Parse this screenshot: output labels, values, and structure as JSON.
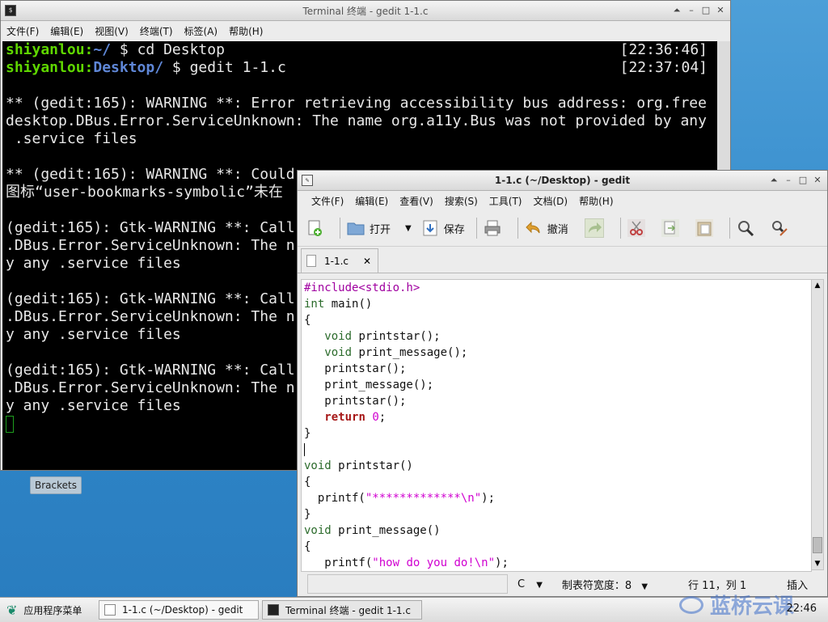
{
  "terminal": {
    "title": "Terminal 终端 - gedit 1-1.c",
    "menu": [
      "文件(F)",
      "编辑(E)",
      "视图(V)",
      "终端(T)",
      "标签(A)",
      "帮助(H)"
    ],
    "lines": [
      {
        "user": "shiyanlou",
        "path": "~/",
        "cmd": " $ cd Desktop",
        "time": "[22:36:46]"
      },
      {
        "user": "shiyanlou",
        "path": "Desktop/",
        "cmd": " $ gedit 1-1.c",
        "time": "[22:37:04]"
      },
      {
        "text": ""
      },
      {
        "text": "** (gedit:165): WARNING **: Error retrieving accessibility bus address: org.free"
      },
      {
        "text": "desktop.DBus.Error.ServiceUnknown: The name org.a11y.Bus was not provided by any"
      },
      {
        "text": " .service files"
      },
      {
        "text": ""
      },
      {
        "text": "** (gedit:165): WARNING **: Could"
      },
      {
        "text": "图标“user-bookmarks-symbolic”未在"
      },
      {
        "text": ""
      },
      {
        "text": "(gedit:165): Gtk-WARNING **: Call"
      },
      {
        "text": ".DBus.Error.ServiceUnknown: The n"
      },
      {
        "text": "y any .service files"
      },
      {
        "text": ""
      },
      {
        "text": "(gedit:165): Gtk-WARNING **: Call"
      },
      {
        "text": ".DBus.Error.ServiceUnknown: The n"
      },
      {
        "text": "y any .service files"
      },
      {
        "text": ""
      },
      {
        "text": "(gedit:165): Gtk-WARNING **: Call"
      },
      {
        "text": ".DBus.Error.ServiceUnknown: The n"
      },
      {
        "text": "y any .service files"
      }
    ]
  },
  "desktop": {
    "brackets_label": "Brackets"
  },
  "gedit": {
    "title": "1-1.c (~/Desktop) - gedit",
    "menu": [
      "文件(F)",
      "编辑(E)",
      "查看(V)",
      "搜索(S)",
      "工具(T)",
      "文档(D)",
      "帮助(H)"
    ],
    "toolbar": {
      "open": "打开",
      "save": "保存",
      "undo": "撤消"
    },
    "tab": "1-1.c",
    "code": [
      [
        [
          "pp",
          "#include<stdio.h>"
        ]
      ],
      [
        [
          "kw",
          "int"
        ],
        [
          "",
          " main()"
        ]
      ],
      [
        [
          "",
          "{"
        ]
      ],
      [
        [
          "",
          "   "
        ],
        [
          "kw",
          "void"
        ],
        [
          "",
          " printstar();"
        ]
      ],
      [
        [
          "",
          "   "
        ],
        [
          "kw",
          "void"
        ],
        [
          "",
          " print_message();"
        ]
      ],
      [
        [
          "",
          "   printstar();"
        ]
      ],
      [
        [
          "",
          "   print_message();"
        ]
      ],
      [
        [
          "",
          "   printstar();"
        ]
      ],
      [
        [
          "",
          "   "
        ],
        [
          "kw2",
          "return"
        ],
        [
          "",
          " "
        ],
        [
          "str",
          "0"
        ],
        [
          "",
          ";"
        ]
      ],
      [
        [
          "",
          "}"
        ]
      ],
      [
        [
          "",
          ""
        ]
      ],
      [
        [
          "kw",
          "void"
        ],
        [
          "",
          " printstar()"
        ]
      ],
      [
        [
          "",
          "{"
        ]
      ],
      [
        [
          "",
          "  printf("
        ],
        [
          "str",
          "\"*************\\n\""
        ],
        [
          "",
          ");"
        ]
      ],
      [
        [
          "",
          "}"
        ]
      ],
      [
        [
          "kw",
          "void"
        ],
        [
          "",
          " print_message()"
        ]
      ],
      [
        [
          "",
          "{"
        ]
      ],
      [
        [
          "",
          "   printf("
        ],
        [
          "str",
          "\"how do you do!\\n\""
        ],
        [
          "",
          ");"
        ]
      ]
    ],
    "status": {
      "lang": "C",
      "tab_width": "制表符宽度：8",
      "position": "行 11，列 1",
      "mode": "插入"
    }
  },
  "taskbar": {
    "menu_label": "应用程序菜单",
    "tasks": [
      "1-1.c (~/Desktop) - gedit",
      "Terminal 终端 - gedit 1-1.c"
    ],
    "clock": "22:46",
    "watermark": "蓝桥云课"
  }
}
